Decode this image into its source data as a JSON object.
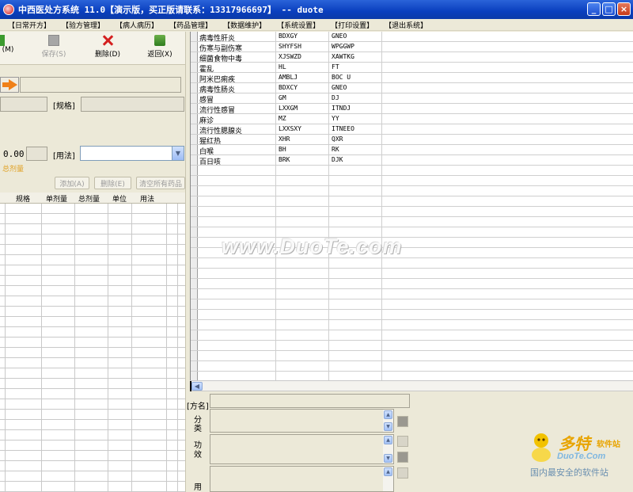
{
  "window": {
    "title": "中西医处方系统 11.0【演示版，买正版请联系：13317966697】 -- duote",
    "buttons": {
      "minimize": "_",
      "maximize": "□",
      "close": "×"
    }
  },
  "menu": {
    "items": [
      "【日常开方】",
      "【验方管理】",
      "【病人病历】",
      "【药品管理】",
      "【数据维护】",
      "【系统设置】",
      "【打印设置】",
      "【退出系统】"
    ]
  },
  "toolbar": {
    "first_partial": "(M)",
    "save": "保存(S)",
    "delete": "删除(D)",
    "back": "返回(X)"
  },
  "form": {
    "spec_label": "[规格]",
    "usage_label": "[用法]",
    "dose_value": "0.00",
    "hint": "总剂量",
    "add_btn": "添加(A)",
    "del_btn": "删除(E)",
    "clear_btn": "清空所有药品"
  },
  "left_table": {
    "columns": [
      "规格",
      "单剂量",
      "总剂量",
      "单位",
      "用法"
    ]
  },
  "right_table": {
    "rows": [
      [
        "病毒性肝炎",
        "BDXGY",
        "GNEO"
      ],
      [
        "伤寒与副伤寒",
        "SHYFSH",
        "WPGGWP"
      ],
      [
        "细菌食物中毒",
        "XJSWZD",
        "XAWTKG"
      ],
      [
        "霍乱",
        "HL",
        "FT"
      ],
      [
        "阿米巴痢疾",
        "AMBLJ",
        "BOC U"
      ],
      [
        "病毒性肠炎",
        "BDXCY",
        "GNEO"
      ],
      [
        "感冒",
        "GM",
        "DJ"
      ],
      [
        "流行性感冒",
        "LXXGM",
        "ITNDJ"
      ],
      [
        "麻诊",
        "MZ",
        "YY"
      ],
      [
        "流行性腮腺炎",
        "LXXSXY",
        "ITNEEO"
      ],
      [
        "猩红热",
        "XHR",
        "QXR"
      ],
      [
        "白喉",
        "BH",
        "RK"
      ],
      [
        "百日咳",
        "BRK",
        "DJK"
      ]
    ]
  },
  "bottom_form": {
    "name_label": "[方名]",
    "category_label_1": "分",
    "category_label_2": "类",
    "effect_label_1": "功",
    "effect_label_2": "效",
    "use_label": "用"
  },
  "watermark": {
    "text": "www.DuoTe.com"
  },
  "logo": {
    "cn": "多特",
    "sub": "软件站",
    "en": "DuoTe.Com",
    "slogan": "国内最安全的软件站"
  }
}
